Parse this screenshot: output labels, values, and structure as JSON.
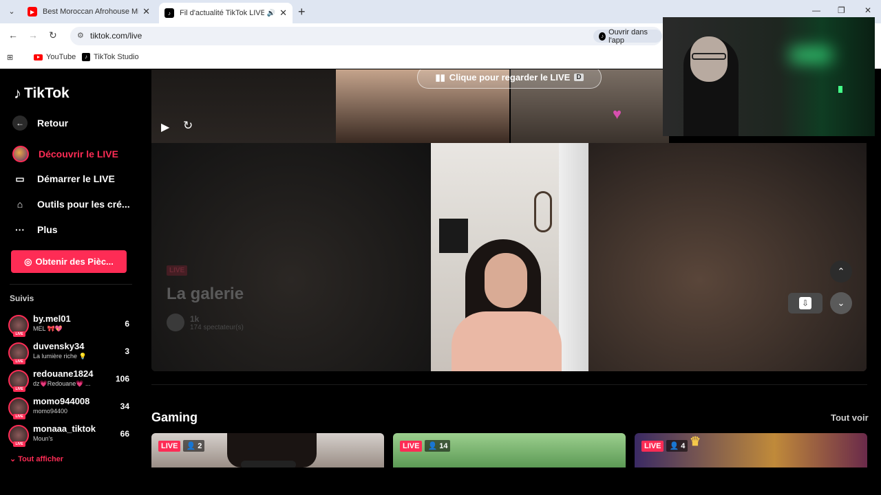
{
  "browser": {
    "tabs": [
      {
        "title": "Best Moroccan Afrohouse Mix",
        "favicon": "youtube-icon",
        "active": false
      },
      {
        "title": "Fil d'actualité TikTok LIVE –",
        "favicon": "tiktok-icon",
        "active": true
      }
    ],
    "url": "tiktok.com/live",
    "open_in_app": "Ouvrir dans l'app",
    "bookmarks": [
      {
        "label": "YouTube",
        "icon": "youtube-icon"
      },
      {
        "label": "TikTok Studio",
        "icon": "tiktok-icon"
      }
    ]
  },
  "sidebar": {
    "logo": "TikTok",
    "back": "Retour",
    "nav": [
      {
        "label": "Découvrir le LIVE",
        "icon": "live-orb-icon",
        "active": true
      },
      {
        "label": "Démarrer le LIVE",
        "icon": "video-camera-icon",
        "active": false
      },
      {
        "label": "Outils pour les cré...",
        "icon": "creator-tools-icon",
        "active": false
      },
      {
        "label": "Plus",
        "icon": "more-icon",
        "active": false
      }
    ],
    "coins_button": "Obtenir des Pièc...",
    "following_label": "Suivis",
    "following": [
      {
        "name": "by.mel01",
        "sub": "MEL 🎀💖",
        "count": "6"
      },
      {
        "name": "duvensky34",
        "sub": "La lumière riche 💡",
        "count": "3"
      },
      {
        "name": "redouane1824",
        "sub": "dz💗Redouane💗 ...",
        "count": "106"
      },
      {
        "name": "momo944008",
        "sub": "momo94400",
        "count": "34"
      },
      {
        "name": "monaaa_tiktok",
        "sub": "Moun's",
        "count": "66"
      }
    ],
    "show_all": "Tout afficher",
    "live_badge": "LIVE"
  },
  "main": {
    "watch_live": "Clique pour regarder le LIVE",
    "watch_key": "D",
    "player": {
      "live_tag": "LIVE",
      "title": "La galerie",
      "host": "1k",
      "viewers": "174 spectateur(s)"
    },
    "section": {
      "title": "Gaming",
      "see_all": "Tout voir",
      "cards": [
        {
          "badge": "LIVE",
          "viewers": "2"
        },
        {
          "badge": "LIVE",
          "viewers": "14"
        },
        {
          "badge": "LIVE",
          "viewers": "4"
        }
      ]
    }
  },
  "colors": {
    "accent": "#fe2c55",
    "background": "#000000"
  }
}
